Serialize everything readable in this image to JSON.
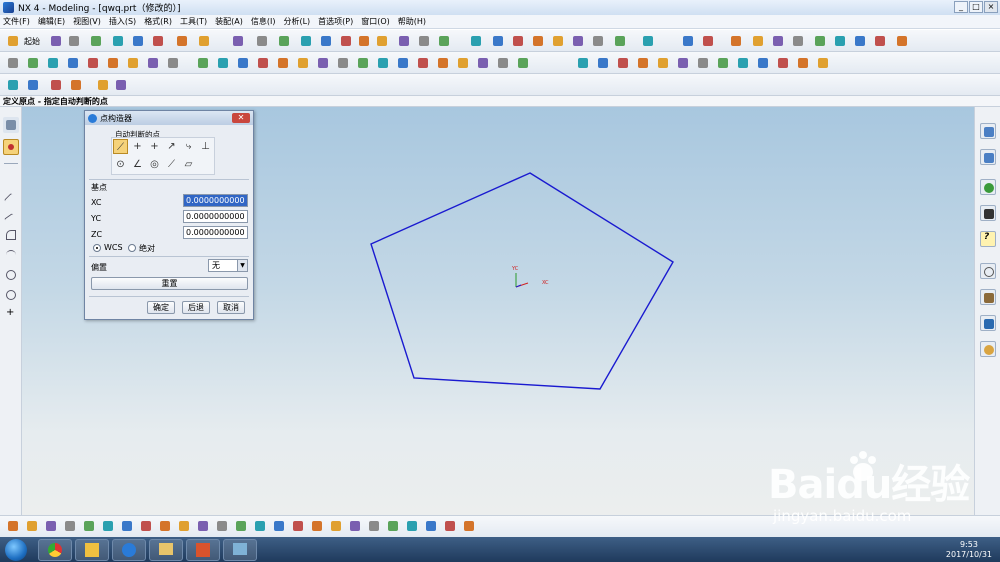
{
  "window": {
    "title": "NX 4 - Modeling - [qwq.prt（修改的）]",
    "controls": [
      "_",
      "□",
      "×"
    ]
  },
  "menu": [
    "文件(F)",
    "编辑(E)",
    "视图(V)",
    "插入(S)",
    "格式(R)",
    "工具(T)",
    "装配(A)",
    "信息(I)",
    "分析(L)",
    "首选项(P)",
    "窗口(O)",
    "帮助(H)"
  ],
  "toolbar": {
    "start_label": "起始"
  },
  "status": {
    "prompt": "定义原点 - 指定自动判断的点"
  },
  "dialog": {
    "title": "点构造器",
    "group_label": "自动判断的点",
    "base_label": "基点",
    "fields": [
      {
        "label": "XC",
        "value": "0.0000000000"
      },
      {
        "label": "YC",
        "value": "0.0000000000"
      },
      {
        "label": "ZC",
        "value": "0.0000000000"
      }
    ],
    "radio_wcs": "WCS",
    "radio_abs": "绝对",
    "offset_label": "偏置",
    "offset_value": "无",
    "reset": "重置",
    "ok": "确定",
    "back": "后退",
    "cancel": "取消"
  },
  "viewport": {
    "triad_y": "YC",
    "triad_x": "XC",
    "shape_color": "#1a1ad0"
  },
  "watermark": {
    "brand": "Baidu经验",
    "url": "jingyan.baidu.com"
  },
  "taskbar": {
    "time": "9:53",
    "date": "2017/10/31"
  }
}
